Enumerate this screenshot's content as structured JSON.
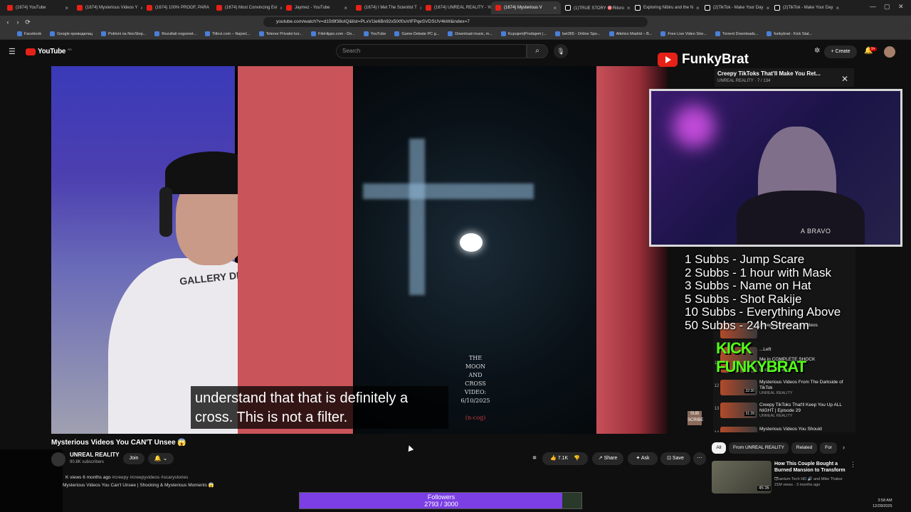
{
  "browser": {
    "tabs": [
      {
        "label": "(1674) YouTube",
        "icon": "youtube-icon"
      },
      {
        "label": "(1674) Mysterious Videos Y",
        "icon": "youtube-icon"
      },
      {
        "label": "(1674) 100% PROOF, PARA",
        "icon": "youtube-icon"
      },
      {
        "label": "(1674) Most Convincing Evi",
        "icon": "youtube-icon"
      },
      {
        "label": "Jaymez - YouTube",
        "icon": "youtube-icon"
      },
      {
        "label": "(1674) I Met The Scientist T",
        "icon": "youtube-icon"
      },
      {
        "label": "(1674) UNREAL REALITY - Yo",
        "icon": "youtube-icon"
      },
      {
        "label": "(1674) Mysterious V",
        "icon": "youtube-icon",
        "active": true
      },
      {
        "label": "(1)TRUE STORY 🎯Ritoro",
        "icon": "tiktok-icon"
      },
      {
        "label": "Exploring Nibiru and the N",
        "icon": "tiktok-icon"
      },
      {
        "label": "(2)TikTok - Make Your Day",
        "icon": "tiktok-icon"
      },
      {
        "label": "(2)TikTok - Make Your Day",
        "icon": "tiktok-icon"
      }
    ],
    "url": "youtube.com/watch?v=d15t9f38oIQ&list=PLxV1le6Bn92x5lXf0uVtFPqeSVDSUV4kW&index=7",
    "bookmarks": [
      "Facebook",
      "Google преводилац",
      "Pokloni na NonStop...",
      "Rezultati nogomet...",
      "Titlovi.com – Najveć...",
      "Telenor Privatni kor...",
      "FileHippo.com - Do...",
      "YouTube",
      "Game-Debate PC g...",
      "Download music, m...",
      "Kupujem|Prodajem |...",
      "bet365 - Online Spo...",
      "Atletico Madrid – B...",
      "Free Live Video Stre...",
      "Torrent Downloads...",
      "funkybrat - Kick Stat..."
    ]
  },
  "youtube": {
    "logo_text": "YouTube",
    "logo_region": "RS",
    "search_placeholder": "Search",
    "create_label": "Create",
    "notif_count": "9+"
  },
  "video": {
    "subtitle": "understand that that is definitely a cross. This is not a filter.",
    "moon_caption": "THE\nMOON\nAND\nCROSS\nVIDEO:\n6/10/2025",
    "moon_handle": "(n-cog)",
    "shirt_text": "GALLERY DEPT",
    "sub_badge": "SUB SCRIBE"
  },
  "stream_overlay": {
    "brand_name": "FunkyBrat",
    "cam_shirt_text": "A BRAVO",
    "mini_player_title": "Creepy TikToks That'll Make You Ret...",
    "mini_player_sub": "UNREAL REALITY · 7 / 134",
    "goals": [
      "1 Subbs - Jump Scare",
      "2 Subbs - 1 hour with Mask",
      "3 Subbs - Name on Hat",
      "5 Subbs - Shot Rakije",
      "10 Subbs - Everything Above",
      "50 Subbs - 24h Stream"
    ],
    "kick_logo": "KICK FUNKYBRAT",
    "followers_label": "Followers",
    "followers_current": 2793,
    "followers_goal": 3000,
    "followers_text": "2793 / 3000"
  },
  "playlist": [
    {
      "num": "",
      "title": "Creepy & Mysterious Videos",
      "channel": "",
      "time": ""
    },
    {
      "num": "",
      "title": "...Left",
      "channel": "",
      "time": ""
    },
    {
      "num": "11",
      "title": "Me in COMPLETE SHOCK",
      "channel": "UNREAL REALITY",
      "time": "31:29"
    },
    {
      "num": "12",
      "title": "Mysterious Videos From The Darkside of TikTok",
      "channel": "UNREAL REALITY",
      "time": "32:30"
    },
    {
      "num": "13",
      "title": "Creepy TikToks That'll Keep You Up ALL NIGHT | Episode 29",
      "channel": "UNREAL REALITY",
      "time": "31:28"
    },
    {
      "num": "14",
      "title": "Mysterious Videos You Should",
      "channel": "",
      "time": ""
    }
  ],
  "watch": {
    "title": "Mysterious Videos You CAN'T Unsee 😱",
    "channel_name": "UNREAL REALITY",
    "channel_subs": "90.8K subscribers",
    "join_label": "Join",
    "like_count": "7.1K",
    "share_label": "Share",
    "ask_label": "Ask",
    "save_label": "Save",
    "views_line": "K views  6 months ago",
    "tags": "#creepy #creepyvideos #scarystories",
    "desc_line2": "Mysterious Videos You Can't Unsee | Shocking & Mysterious Moments 😱"
  },
  "chips": [
    "All",
    "From UNREAL REALITY",
    "Related",
    "For"
  ],
  "recommendation": {
    "title": "How This Couple Bought a Burned Mansion to Transform ...",
    "channel": "Quantum Tech HD 🔊 and Mike Thakur",
    "meta": "21M views · 3 months ago",
    "time": "45:35"
  },
  "system": {
    "time": "3:58 AM",
    "date": "12/28/2025"
  }
}
